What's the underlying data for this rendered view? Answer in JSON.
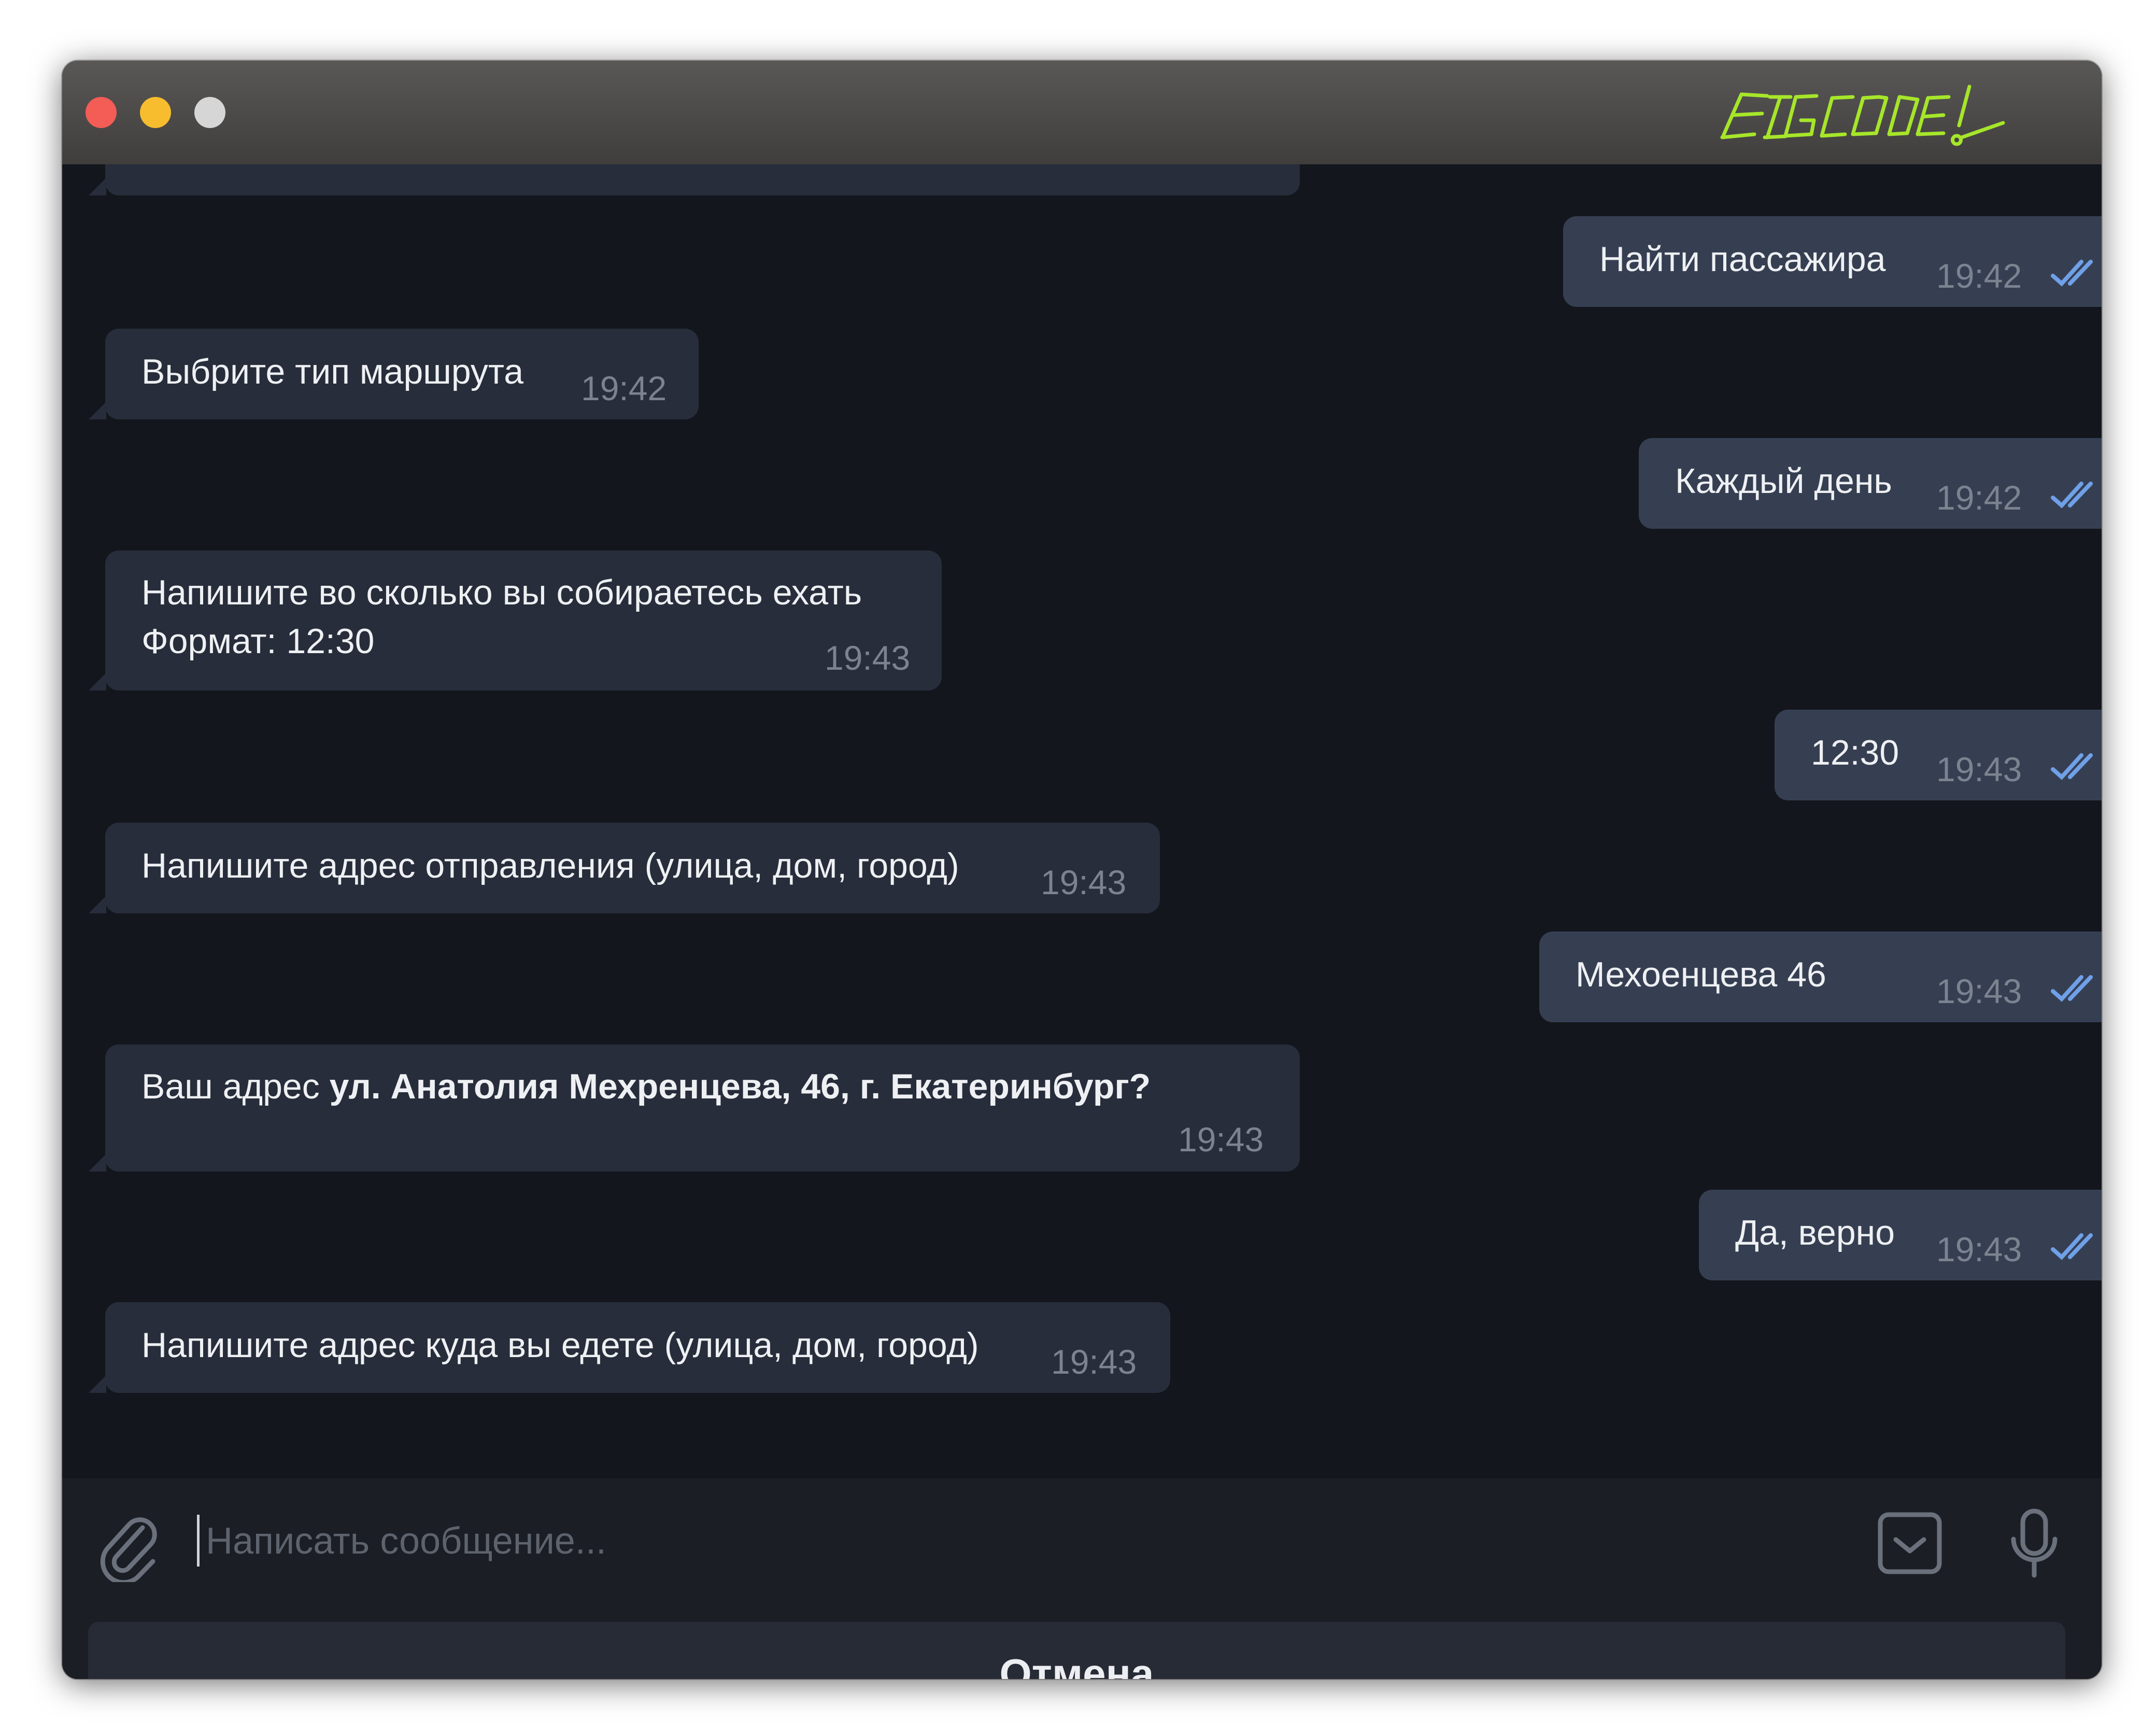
{
  "window": {
    "logo_text": "BIG CODE!",
    "accent_logo_color": "#a6e62a"
  },
  "messages": [
    {
      "dir": "out",
      "text": "Найти пассажира",
      "time": "19:42",
      "read": true
    },
    {
      "dir": "in",
      "text": "Выбрите тип маршрута",
      "time": "19:42"
    },
    {
      "dir": "out",
      "text": "Каждый день",
      "time": "19:42",
      "read": true
    },
    {
      "dir": "in",
      "line1": "Напишите во сколько вы собираетесь ехать",
      "line2": "Формат: 12:30",
      "time": "19:43"
    },
    {
      "dir": "out",
      "text": "12:30",
      "time": "19:43",
      "read": true
    },
    {
      "dir": "in",
      "text": "Напишите адрес отправления (улица, дом, город)",
      "time": "19:43"
    },
    {
      "dir": "out",
      "text": "Мехоенцева 46",
      "time": "19:43",
      "read": true
    },
    {
      "dir": "in",
      "prefix": "Ваш адрес ",
      "bold": "ул. Анатолия Мехренцева, 46, г. Екатеринбург?",
      "time": "19:43"
    },
    {
      "dir": "out",
      "text": "Да, верно",
      "time": "19:43",
      "read": true
    },
    {
      "dir": "in",
      "text": "Напишите адрес куда вы едете (улица, дом, город)",
      "time": "19:43"
    }
  ],
  "composer": {
    "placeholder": "Написать сообщение...",
    "attach_icon": "paperclip-icon",
    "keyboard_icon": "bot-keyboard-icon",
    "mic_icon": "microphone-icon"
  },
  "keyboard": {
    "cancel_label": "Отмена"
  }
}
